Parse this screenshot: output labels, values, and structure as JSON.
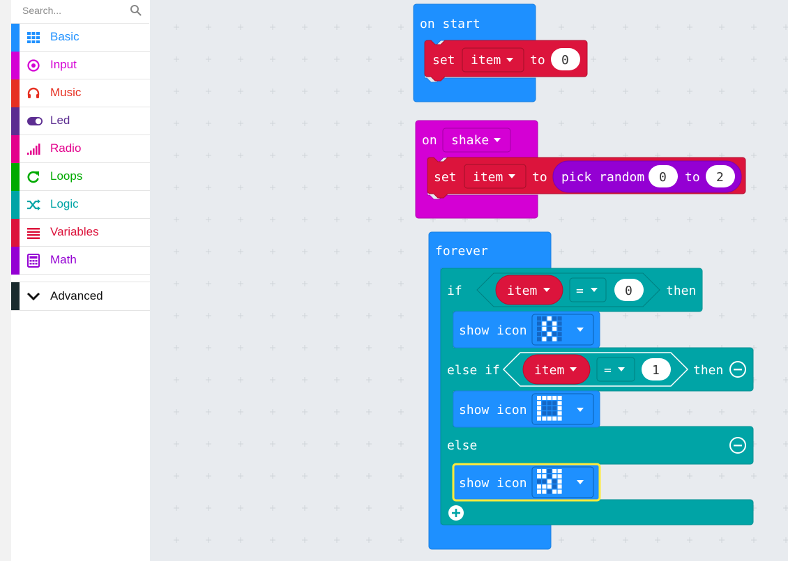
{
  "toolbox": {
    "search_placeholder": "Search...",
    "categories": [
      {
        "label": "Basic",
        "color": "#1e90ff",
        "icon": "grid-icon"
      },
      {
        "label": "Input",
        "color": "#d400d4",
        "icon": "target-icon"
      },
      {
        "label": "Music",
        "color": "#e63022",
        "icon": "headphones-icon"
      },
      {
        "label": "Led",
        "color": "#5c2d91",
        "icon": "toggle-icon"
      },
      {
        "label": "Radio",
        "color": "#e3008c",
        "icon": "signal-bars-icon"
      },
      {
        "label": "Loops",
        "color": "#00aa00",
        "icon": "refresh-icon"
      },
      {
        "label": "Logic",
        "color": "#00a4a6",
        "icon": "shuffle-icon"
      },
      {
        "label": "Variables",
        "color": "#dc143c",
        "icon": "list-icon"
      },
      {
        "label": "Math",
        "color": "#9400d3",
        "icon": "calculator-icon"
      }
    ],
    "advanced_label": "Advanced"
  },
  "blocks": {
    "on_start": {
      "label": "on start",
      "set": "set",
      "var": "item",
      "to": "to",
      "value": "0"
    },
    "on_shake": {
      "on": "on",
      "gesture": "shake",
      "set": "set",
      "var": "item",
      "to": "to",
      "pick_random": "pick random",
      "from": "0",
      "to2": "to",
      "max": "2"
    },
    "forever": {
      "label": "forever",
      "if": "if",
      "var1": "item",
      "op1": "=",
      "val1": "0",
      "then": "then",
      "show_icon": "show icon",
      "else_if": "else if",
      "var2": "item",
      "op2": "=",
      "val2": "1",
      "else": "else"
    }
  },
  "colors": {
    "basic": "#1e90ff",
    "input": "#d400d4",
    "variables": "#dc143c",
    "logic": "#00a4a6",
    "math": "#9400d3",
    "highlight": "#ffeb3b"
  }
}
